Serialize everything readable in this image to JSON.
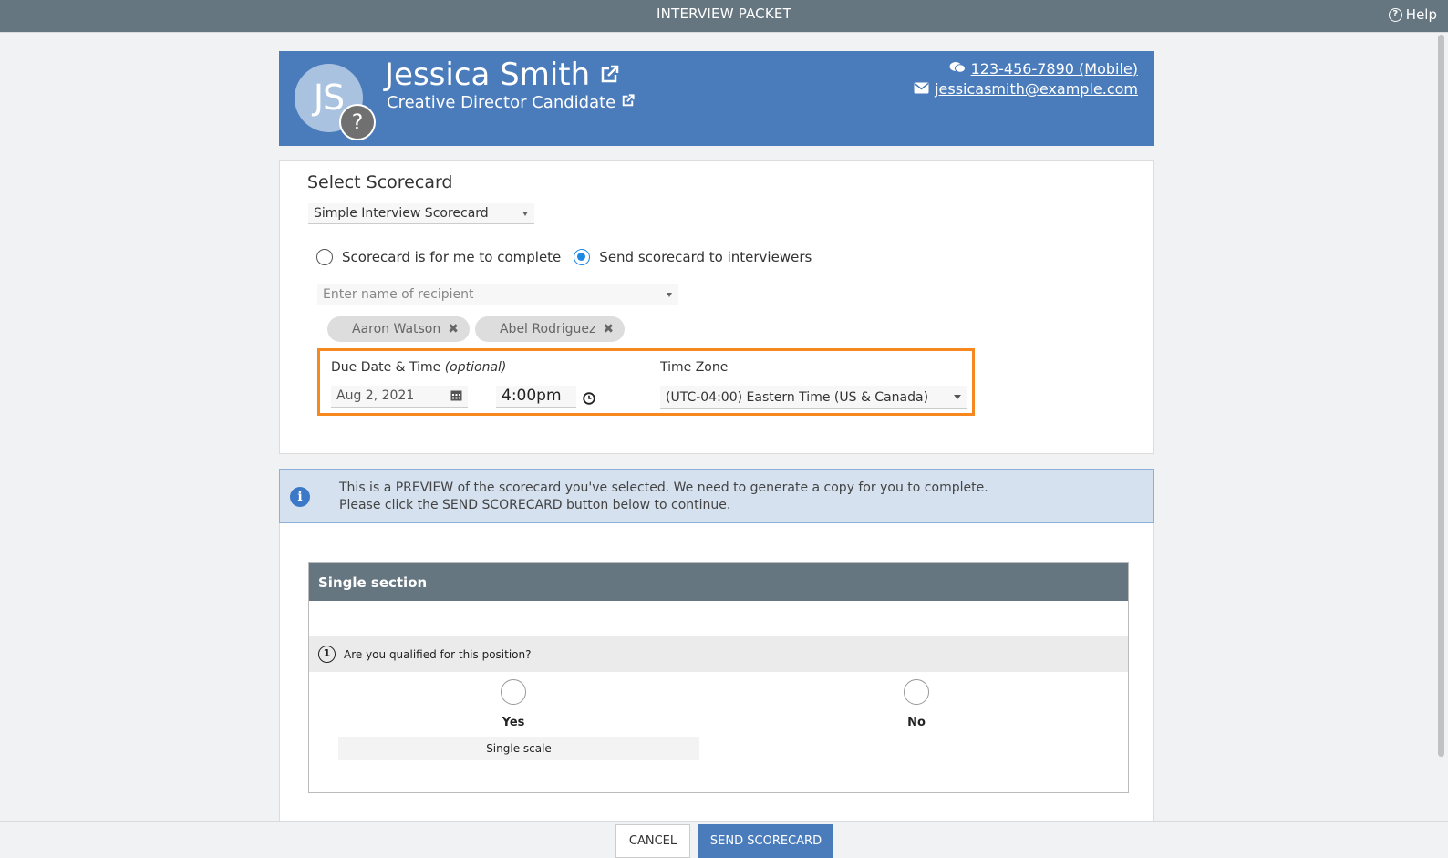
{
  "topbar": {
    "title": "INTERVIEW PACKET",
    "help_label": "Help"
  },
  "candidate": {
    "initials": "JS",
    "avatar_badge": "?",
    "name": "Jessica Smith",
    "role": "Creative Director Candidate",
    "phone": "123-456-7890 (Mobile)",
    "email": "jessicasmith@example.com"
  },
  "form": {
    "title": "Select Scorecard",
    "scorecard_selected": "Simple Interview Scorecard",
    "radio_self": "Scorecard is for me to complete",
    "radio_send": "Send scorecard to interviewers",
    "radio_selected": "send",
    "recipient_placeholder": "Enter name of recipient",
    "recipients": [
      "Aaron Watson",
      "Abel Rodriguez"
    ],
    "due_label": "Due Date & Time",
    "due_optional": "(optional)",
    "timezone_label": "Time Zone",
    "due_date": "Aug 2, 2021",
    "due_time": "4:00pm",
    "timezone": "(UTC-04:00) Eastern Time (US & Canada)"
  },
  "info": {
    "line1": "This is a PREVIEW of the scorecard you've selected. We need to generate a copy for you to complete.",
    "line2": "Please click the SEND SCORECARD button below to continue."
  },
  "preview": {
    "section_title": "Single section",
    "question_number": "1",
    "question": "Are you qualified for this position?",
    "options": [
      "Yes",
      "No"
    ],
    "scale_label": "Single scale"
  },
  "footer": {
    "cancel_label": "CANCEL",
    "send_label": "SEND SCORECARD"
  },
  "colors": {
    "header_blue": "#4a7bbb",
    "topbar_gray": "#657680",
    "highlight_orange": "#f7871f",
    "radio_blue": "#1e88e5"
  }
}
